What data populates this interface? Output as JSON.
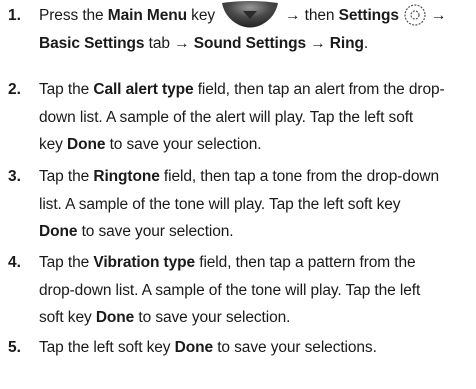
{
  "steps": [
    {
      "number": "1.",
      "line1": {
        "t1": "Press the ",
        "b1": "Main Menu",
        "t2": " key",
        "arrow1": "→",
        "t3": " then ",
        "b2": "Settings",
        "arrow2": "→"
      },
      "line2": {
        "b1": "Basic Settings",
        "t1": " tab ",
        "arrow1": "→",
        "b2": " Sound Settings ",
        "arrow2": "→",
        "b3": " Ring",
        "t2": "."
      }
    },
    {
      "number": "2.",
      "l1a": "Tap the ",
      "l1b": "Call alert type",
      "l1c": " field, then tap an alert from the drop-",
      "l2": "down list. A sample of the alert will play. Tap the left soft",
      "l3a": "key ",
      "l3b": "Done",
      "l3c": " to save your selection."
    },
    {
      "number": "3.",
      "l1a": "Tap the ",
      "l1b": "Ringtone",
      "l1c": " field, then tap a tone from the drop-down",
      "l2": "list. A sample of the tone will play. Tap the left soft key",
      "l3a": "Done",
      "l3b": " to save your selection."
    },
    {
      "number": "4.",
      "l1a": "Tap the ",
      "l1b": "Vibration type",
      "l1c": " field, then tap a pattern from the",
      "l2": "drop-down list. A sample of the tone will play. Tap the left",
      "l3a": "soft key ",
      "l3b": "Done",
      "l3c": " to save your selection."
    },
    {
      "number": "5.",
      "l1a": "Tap the left soft key ",
      "l1b": "Done",
      "l1c": " to save your selections."
    }
  ]
}
